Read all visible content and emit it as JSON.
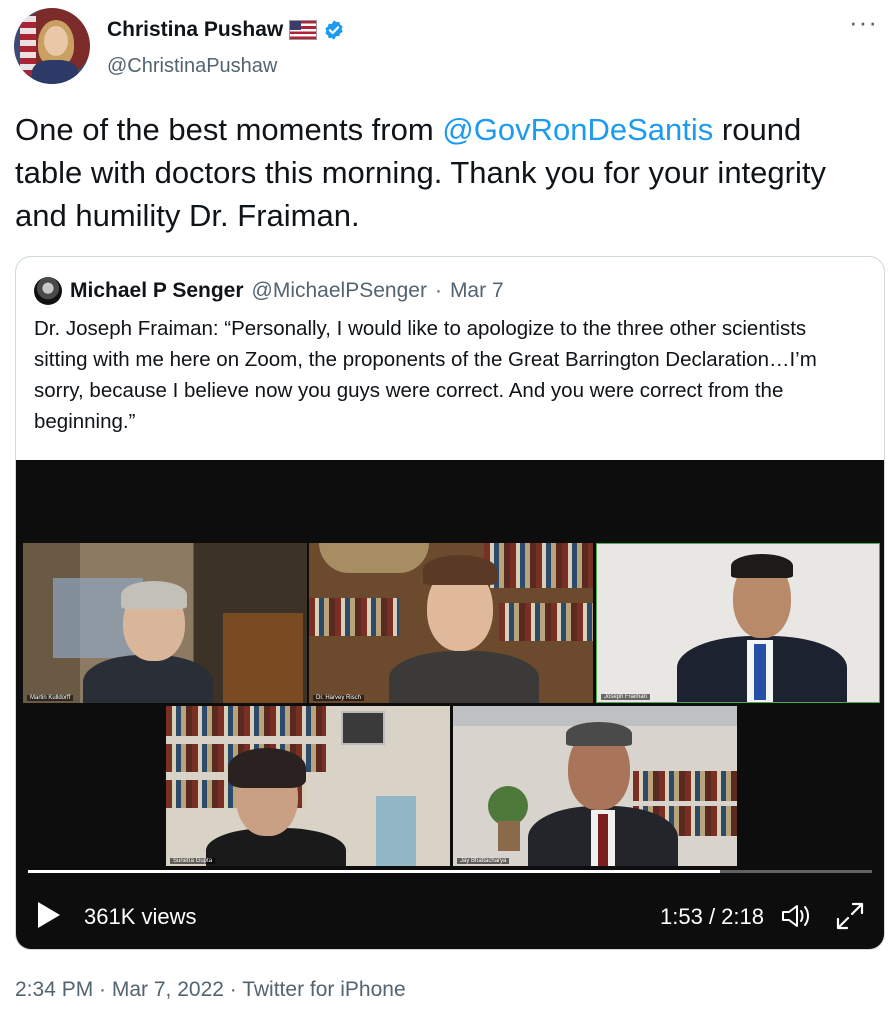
{
  "author": {
    "display_name": "Christina Pushaw",
    "handle": "@ChristinaPushaw",
    "flag_icon": "us-flag-icon",
    "verified_icon": "verified-badge-icon"
  },
  "more_menu": "···",
  "tweet": {
    "mention": "@GovRonDeSantis",
    "text_before": "One of the best moments from ",
    "text_after": " round table with doctors this morning. Thank you for your integrity and humility Dr. Fraiman."
  },
  "quote": {
    "display_name": "Michael P Senger",
    "handle": "@MichaelPSenger",
    "separator": "·",
    "date": "Mar 7",
    "text": "Dr. Joseph Fraiman: “Personally, I would like to apologize to the three other scientists sitting with me here on Zoom, the proponents of the Great Barrington Declaration…I’m sorry, because I believe now you guys were correct. And you were correct from the beginning.”"
  },
  "video": {
    "participants": [
      "Martin Kulldorff",
      "Dr. Harvey Risch",
      "Joseph Fraiman",
      "Sunetra Gupta",
      "Jay Bhattacharya"
    ],
    "views": "361K views",
    "time": "1:53 / 2:18",
    "progress_fraction": 0.82
  },
  "footer": {
    "timestamp": "2:34 PM · Mar 7, 2022 · Twitter for iPhone"
  },
  "colors": {
    "link": "#1d9bf0",
    "muted": "#536471",
    "text": "#0f1419",
    "active_speaker_border": "#4caf50"
  }
}
